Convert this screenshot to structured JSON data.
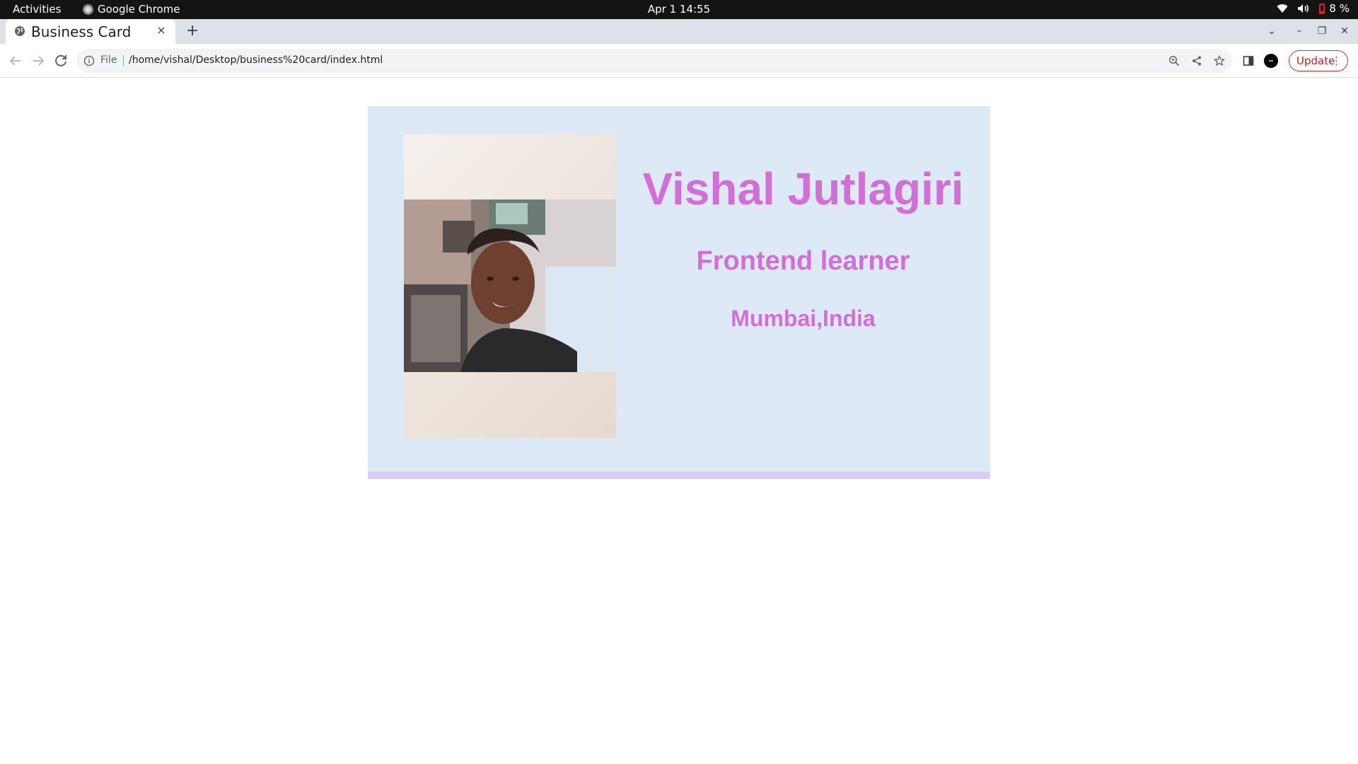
{
  "os_topbar": {
    "activities_label": "Activities",
    "app_name": "Google Chrome",
    "clock": "Apr 1  14:55",
    "battery_percent": "8 %",
    "icons": [
      "wifi-icon",
      "volume-icon",
      "battery-icon"
    ]
  },
  "browser": {
    "tab": {
      "title": "Business Card",
      "close_label": "×"
    },
    "new_tab_label": "+",
    "window_controls": {
      "tab_search": "⌄",
      "minimize": "–",
      "restore": "❐",
      "close": "✕"
    },
    "toolbar": {
      "scheme_label": "File",
      "url": "/home/vishal/Desktop/business%20card/index.html",
      "update_label": "Update",
      "menu_label": "⋮"
    }
  },
  "card": {
    "name": "Vishal Jutlagiri",
    "role": "Frontend learner",
    "location": "Mumbai,India",
    "colors": {
      "background": "#dee9f7",
      "accent_text": "#d16fd6",
      "bottom_border": "#d8cdf7"
    }
  }
}
